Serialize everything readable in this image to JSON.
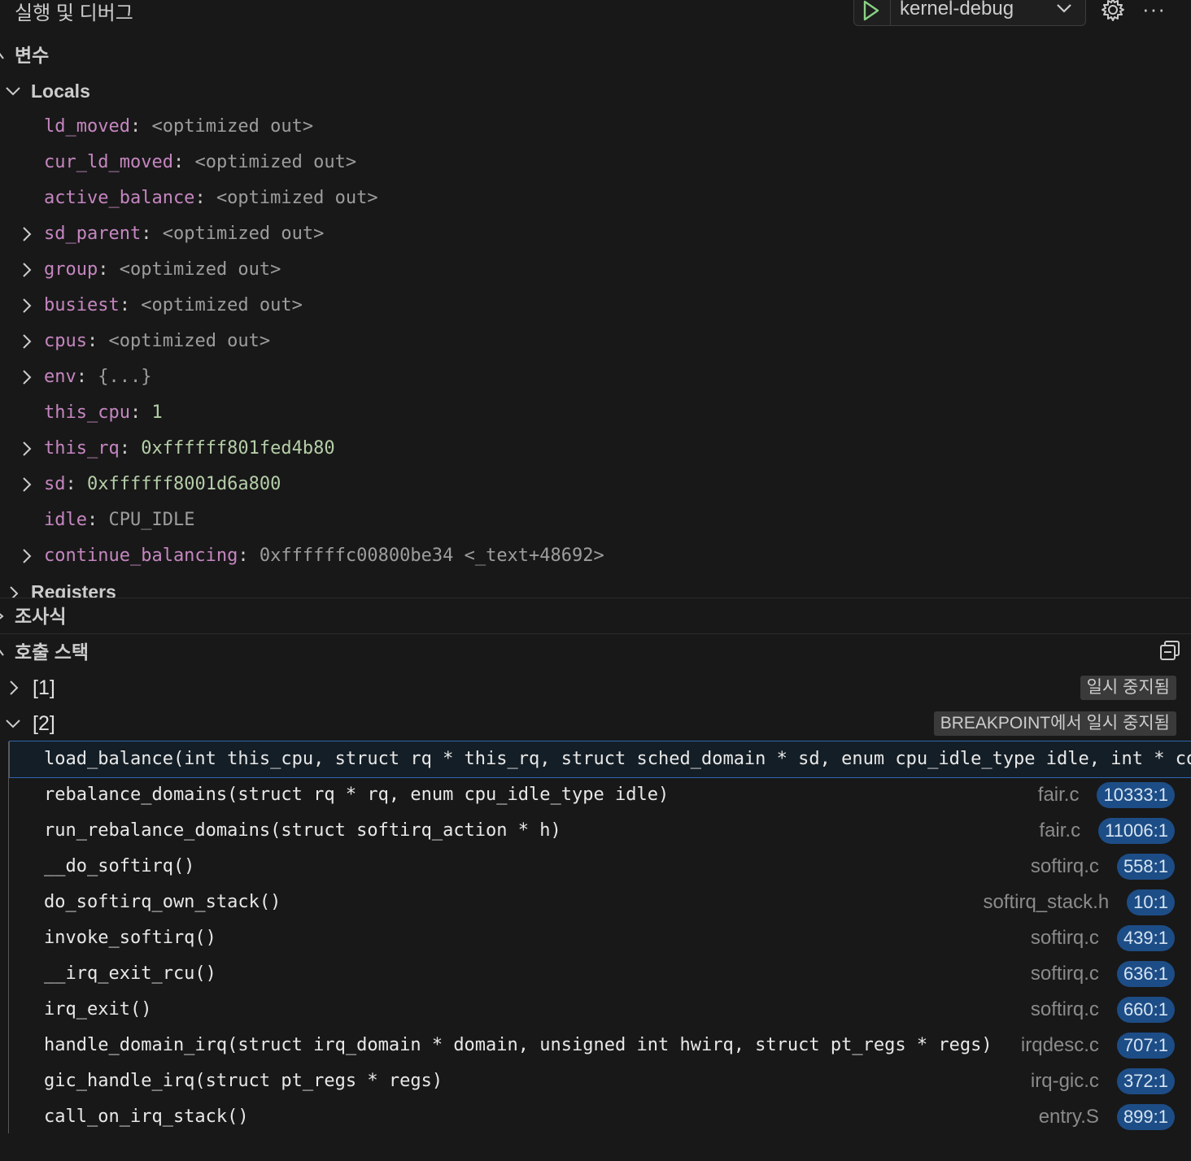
{
  "header": {
    "title": "실행 및 디버그",
    "config_name": "kernel-debug",
    "more_label": "···"
  },
  "variables": {
    "section_title": "변수",
    "locals_title": "Locals",
    "registers_title": "Registers",
    "items": [
      {
        "name": "ld_moved",
        "sep": ": ",
        "value": "<optimized out>",
        "expandable": false,
        "kind": "dim"
      },
      {
        "name": "cur_ld_moved",
        "sep": ": ",
        "value": "<optimized out>",
        "expandable": false,
        "kind": "dim"
      },
      {
        "name": "active_balance",
        "sep": ": ",
        "value": "<optimized out>",
        "expandable": false,
        "kind": "dim"
      },
      {
        "name": "sd_parent",
        "sep": ": ",
        "value": "<optimized out>",
        "expandable": true,
        "kind": "dim"
      },
      {
        "name": "group",
        "sep": ": ",
        "value": "<optimized out>",
        "expandable": true,
        "kind": "dim"
      },
      {
        "name": "busiest",
        "sep": ": ",
        "value": "<optimized out>",
        "expandable": true,
        "kind": "dim"
      },
      {
        "name": "cpus",
        "sep": ": ",
        "value": "<optimized out>",
        "expandable": true,
        "kind": "dim"
      },
      {
        "name": "env",
        "sep": ": ",
        "value": "{...}",
        "expandable": true,
        "kind": "dim"
      },
      {
        "name": "this_cpu",
        "sep": ": ",
        "value": "1",
        "expandable": false,
        "kind": "num"
      },
      {
        "name": "this_rq",
        "sep": ": ",
        "value": "0xffffff801fed4b80",
        "expandable": true,
        "kind": "addr"
      },
      {
        "name": "sd",
        "sep": ": ",
        "value": "0xffffff8001d6a800",
        "expandable": true,
        "kind": "addr"
      },
      {
        "name": "idle",
        "sep": ": ",
        "value": "CPU_IDLE",
        "expandable": false,
        "kind": "dim"
      },
      {
        "name": "continue_balancing",
        "sep": ": ",
        "value": "0xffffffc00800be34 <_text+48692>",
        "expandable": true,
        "kind": "dim"
      }
    ]
  },
  "watch": {
    "section_title": "조사식"
  },
  "callstack": {
    "section_title": "호출 스택",
    "threads": [
      {
        "label": "[1]",
        "status": "일시 중지됨",
        "expanded": false
      },
      {
        "label": "[2]",
        "status": "BREAKPOINT에서 일시 중지됨",
        "expanded": true
      }
    ],
    "frames": [
      {
        "text": "load_balance(int this_cpu, struct rq * this_rq, struct sched_domain * sd, enum cpu_idle_type idle, int * co",
        "file": "",
        "line": ""
      },
      {
        "text": "rebalance_domains(struct rq * rq, enum cpu_idle_type idle)",
        "file": "fair.c",
        "line": "10333:1"
      },
      {
        "text": "run_rebalance_domains(struct softirq_action * h)",
        "file": "fair.c",
        "line": "11006:1"
      },
      {
        "text": "__do_softirq()",
        "file": "softirq.c",
        "line": "558:1"
      },
      {
        "text": "do_softirq_own_stack()",
        "file": "softirq_stack.h",
        "line": "10:1"
      },
      {
        "text": "invoke_softirq()",
        "file": "softirq.c",
        "line": "439:1"
      },
      {
        "text": "__irq_exit_rcu()",
        "file": "softirq.c",
        "line": "636:1"
      },
      {
        "text": "irq_exit()",
        "file": "softirq.c",
        "line": "660:1"
      },
      {
        "text": "handle_domain_irq(struct irq_domain * domain, unsigned int hwirq, struct pt_regs * regs)",
        "file": "irqdesc.c",
        "line": "707:1"
      },
      {
        "text": "gic_handle_irq(struct pt_regs * regs)",
        "file": "irq-gic.c",
        "line": "372:1"
      },
      {
        "text": "call_on_irq_stack()",
        "file": "entry.S",
        "line": "899:1"
      }
    ]
  }
}
